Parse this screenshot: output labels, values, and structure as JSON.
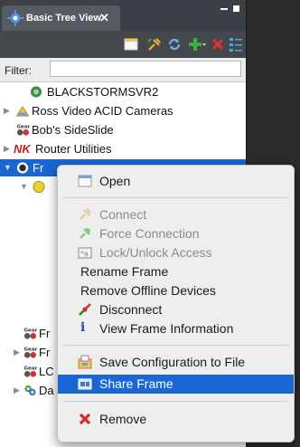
{
  "tab": {
    "title": "Basic Tree View",
    "close": "✕"
  },
  "filter": {
    "label": "Filter:",
    "value": ""
  },
  "tree": {
    "items": [
      {
        "label": "BLACKSTORMSVR2"
      },
      {
        "label": "Ross Video ACID Cameras"
      },
      {
        "label": "Bob's SideSlide"
      },
      {
        "label": "Router Utilities",
        "prefix": "NK"
      },
      {
        "label": "Fr"
      },
      {
        "label": "Fr"
      },
      {
        "label": "Fr"
      },
      {
        "label": "LC"
      },
      {
        "label": "Da"
      }
    ]
  },
  "menu": {
    "open": "Open",
    "connect": "Connect",
    "force_connection": "Force Connection",
    "lock_unlock": "Lock/Unlock Access",
    "rename": "Rename Frame",
    "remove_offline": "Remove Offline Devices",
    "disconnect": "Disconnect",
    "view_info": "View Frame Information",
    "save_config": "Save Configuration to File",
    "share_frame": "Share Frame",
    "remove": "Remove"
  },
  "colors": {
    "selection": "#1966d0",
    "menu_highlight": "#1a66d2",
    "remove_red": "#d42a2a",
    "add_green": "#3cb043"
  }
}
